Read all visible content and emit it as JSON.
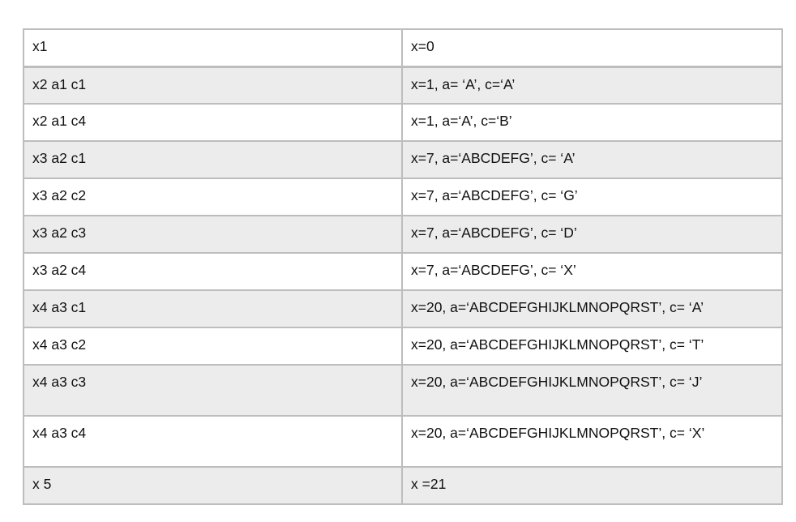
{
  "table": {
    "rows": [
      [
        "x1",
        "x=0"
      ],
      [
        "x2 a1 c1",
        "x=1, a= ‘A’, c=‘A’"
      ],
      [
        "x2 a1 c4",
        "x=1, a=‘A’, c=‘B’"
      ],
      [
        "x3 a2 c1",
        "x=7, a=‘ABCDEFG’, c= ‘A’"
      ],
      [
        "x3 a2 c2",
        "x=7, a=‘ABCDEFG’, c= ‘G’"
      ],
      [
        "x3 a2 c3",
        "x=7, a=‘ABCDEFG’, c= ‘D’"
      ],
      [
        "x3 a2 c4",
        "x=7, a=‘ABCDEFG’, c= ‘X’"
      ],
      [
        "x4 a3 c1",
        "x=20, a=‘ABCDEFGHIJKLMNOPQRST’, c= ‘A’"
      ],
      [
        "x4 a3 c2",
        "x=20, a=‘ABCDEFGHIJKLMNOPQRST’, c= ‘T’"
      ],
      [
        "x4 a3 c3",
        "x=20, a=‘ABCDEFGHIJKLMNOPQRST’, c= ‘J’"
      ],
      [
        "x4 a3 c4",
        "x=20, a=‘ABCDEFGHIJKLMNOPQRST’, c= ‘X’"
      ],
      [
        "x 5",
        "x =21"
      ]
    ]
  },
  "colors": {
    "shaded_row": "#ececec",
    "border": "#bdbdbd"
  }
}
